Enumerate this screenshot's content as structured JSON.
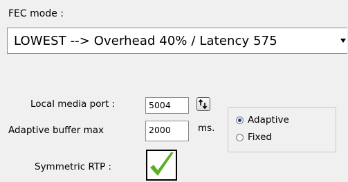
{
  "fec": {
    "label": "FEC mode :",
    "selected": "LOWEST --> Overhead 40% / Latency 575"
  },
  "media_port": {
    "label": "Local media port :",
    "value": "5004"
  },
  "adaptive_buffer": {
    "label": "Adaptive buffer max",
    "value": "2000",
    "unit": "ms."
  },
  "buffer_mode": {
    "options": [
      {
        "label": "Adaptive",
        "checked": true
      },
      {
        "label": "Fixed",
        "checked": false
      }
    ]
  },
  "symmetric_rtp": {
    "label": "Symmetric RTP :",
    "checked": true
  },
  "colors": {
    "check": "#5ab025",
    "radio_dot": "#1f3f7a"
  }
}
